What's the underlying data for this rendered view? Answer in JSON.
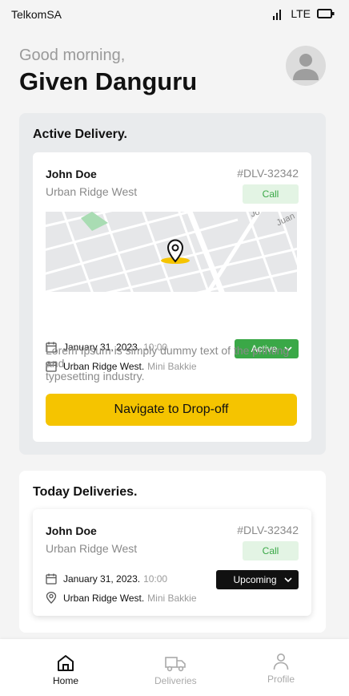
{
  "status_bar": {
    "carrier": "TelkomSA",
    "network": "LTE"
  },
  "header": {
    "greeting": "Good morning,",
    "user_name": "Given Danguru"
  },
  "active_delivery": {
    "title": "Active Delivery.",
    "name": "John Doe",
    "area": "Urban Ridge West",
    "id": "#DLV-32342",
    "call_label": "Call",
    "map_labels": {
      "street_1": "Jo",
      "street_2": "Juan"
    },
    "date": "January 31, 2023.",
    "time": "10:00",
    "location": "Urban Ridge West.",
    "vehicle": "Mini Bakkie",
    "status": "Active",
    "status_color": "#3aa847",
    "description_line1": "Lorem Ipsum is simply dummy text of the printing and",
    "description_line2": "typesetting industry.",
    "navigate_label": "Navigate to Drop-off"
  },
  "today_deliveries": {
    "title": "Today Deliveries.",
    "items": [
      {
        "name": "John Doe",
        "area": "Urban Ridge West",
        "id": "#DLV-32342",
        "call_label": "Call",
        "date": "January 31, 2023.",
        "time": "10:00",
        "location": "Urban Ridge West.",
        "vehicle": "Mini Bakkie",
        "status": "Upcoming",
        "status_color": "#111111"
      }
    ]
  },
  "bottom_nav": {
    "items": [
      {
        "label": "Home",
        "icon": "home-icon",
        "active": true
      },
      {
        "label": "Deliveries",
        "icon": "truck-icon",
        "active": false
      },
      {
        "label": "Profile",
        "icon": "person-icon",
        "active": false
      }
    ]
  },
  "colors": {
    "accent": "#f5c400",
    "success": "#3aa847",
    "call_bg": "#e3f4e4"
  }
}
